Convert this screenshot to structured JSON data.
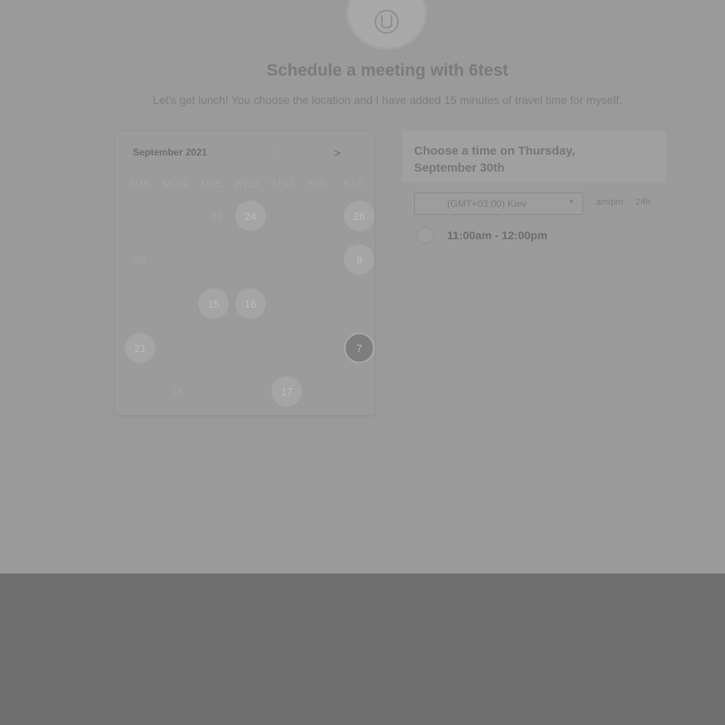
{
  "header": {
    "title": "Schedule a meeting with 6test",
    "subtitle": "Let's get lunch! You choose the location and I have added 15 minutes of travel time for myself."
  },
  "calendar": {
    "month_label": "September 2021",
    "prev_icon": "‹",
    "next_icon": ">",
    "weekdays": [
      "SUN",
      "MON",
      "TUE",
      "WED",
      "THU",
      "FRI",
      "SAT"
    ],
    "days": {
      "d23": "23",
      "d24": "24",
      "d26": "26",
      "d29": "29",
      "d9": "9",
      "d15": "15",
      "d16": "16",
      "d21": "21",
      "d7": "7",
      "d16b": "16",
      "d17": "17"
    }
  },
  "time_panel": {
    "title": "Choose a time on Thursday, September 30th",
    "timezone": "(GMT+03:00) Kiev",
    "caret_icon": "▼",
    "format_ampm": "am/pm",
    "format_24h": "24h",
    "slot": "11:00am - 12:00pm"
  },
  "colors": {
    "overlay": "#9a9a9a",
    "footer": "#6f6f6f"
  }
}
